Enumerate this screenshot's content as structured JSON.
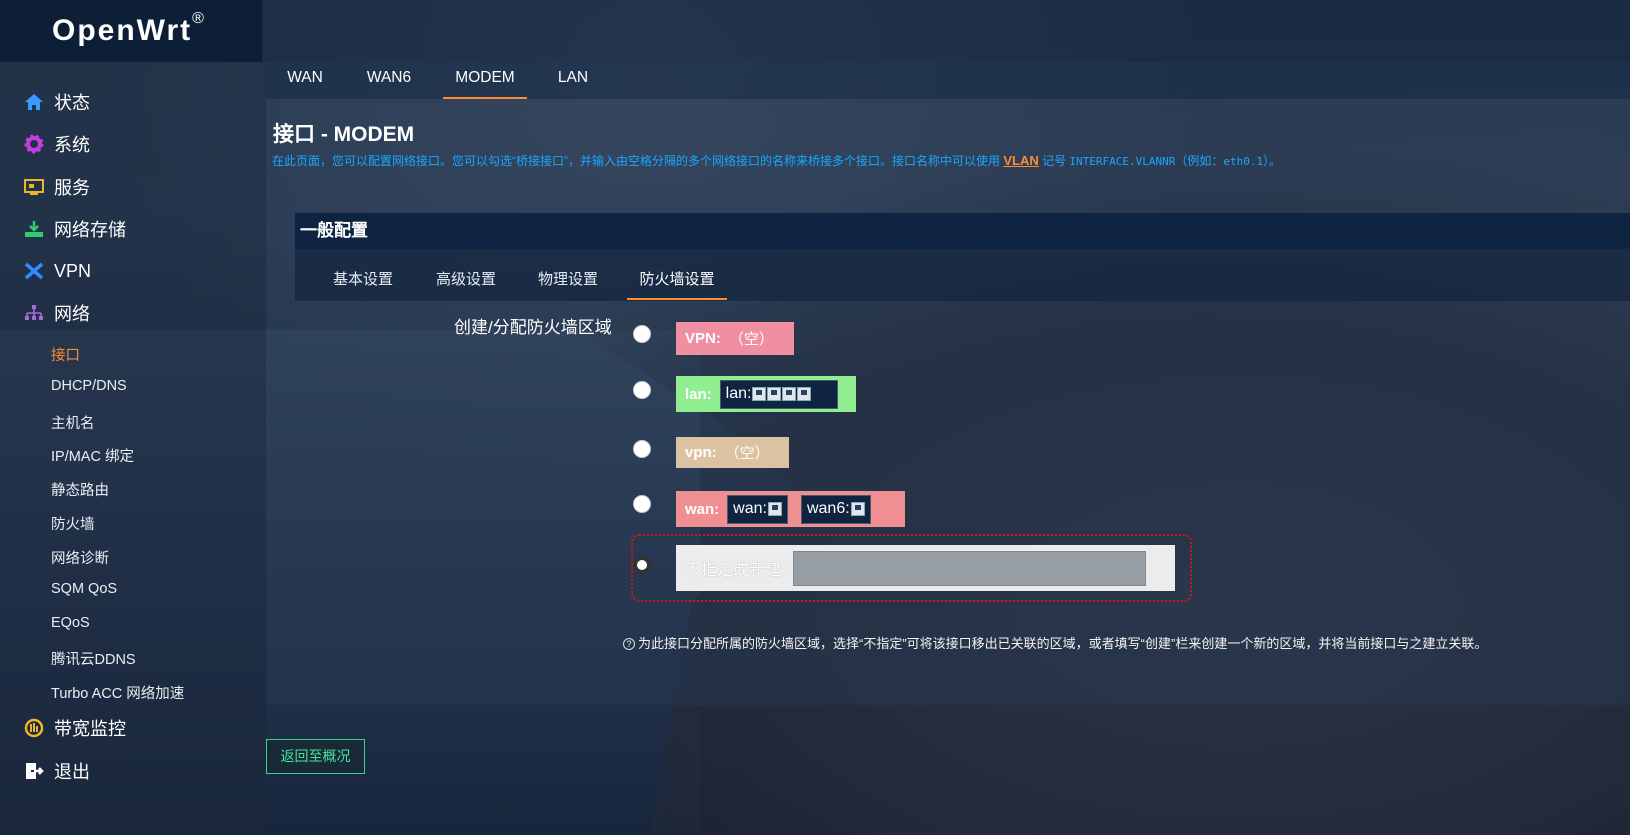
{
  "brand": {
    "name": "OpenWrt",
    "mark": "®"
  },
  "sidebar": {
    "items": [
      {
        "label": "状态",
        "icon": "home-icon"
      },
      {
        "label": "系统",
        "icon": "gear-icon"
      },
      {
        "label": "服务",
        "icon": "services-icon"
      },
      {
        "label": "网络存储",
        "icon": "storage-icon"
      },
      {
        "label": "VPN",
        "icon": "vpn-icon"
      },
      {
        "label": "网络",
        "icon": "network-icon"
      }
    ],
    "network_sub": [
      "接口",
      "DHCP/DNS",
      "主机名",
      "IP/MAC 绑定",
      "静态路由",
      "防火墙",
      "网络诊断",
      "SQM QoS",
      "EQoS",
      "腾讯云DDNS",
      "Turbo ACC 网络加速"
    ],
    "active_sub": "接口",
    "bottom_items": [
      {
        "label": "带宽监控",
        "icon": "bandwidth-icon"
      },
      {
        "label": "退出",
        "icon": "logout-icon"
      }
    ]
  },
  "interface_tabs": [
    "WAN",
    "WAN6",
    "MODEM",
    "LAN"
  ],
  "active_interface_tab": "MODEM",
  "page": {
    "title": "接口 - MODEM",
    "desc_before": "在此页面，您可以配置网络接口。您可以勾选“桥接接口”，并输入由空格分隔的多个网络接口的名称来桥接多个接口。接口名称中可以使用 ",
    "desc_link": "VLAN",
    "desc_mid": " 记号 ",
    "desc_code": "INTERFACE.VLANNR",
    "desc_after": "（例如：",
    "desc_example": "eth0.1",
    "desc_end": "）。"
  },
  "section": {
    "title": "一般配置",
    "tabs": [
      "基本设置",
      "高级设置",
      "物理设置",
      "防火墙设置"
    ],
    "active_tab": "防火墙设置"
  },
  "firewall": {
    "field_label": "创建/分配防火墙区域",
    "zones": [
      {
        "name": "VPN:",
        "empty_text": "（空）",
        "color": "#f08fa2"
      },
      {
        "name": "lan:",
        "interfaces": [
          "lan:"
        ],
        "color": "#90ee90"
      },
      {
        "name": "vpn:",
        "empty_text": "（空）",
        "color": "#dcc2a0"
      },
      {
        "name": "wan:",
        "interfaces": [
          "wan:",
          "wan6:"
        ],
        "color": "#f08f92"
      }
    ],
    "new_zone_label": "不指定或新建:",
    "new_zone_value": "",
    "help_text": "为此接口分配所属的防火墙区域，选择“不指定”可将该接口移出已关联的区域，或者填写“创建”栏来创建一个新的区域，并将当前接口与之建立关联。"
  },
  "back_button": "返回至概况",
  "accent_color": "#ff8c32"
}
